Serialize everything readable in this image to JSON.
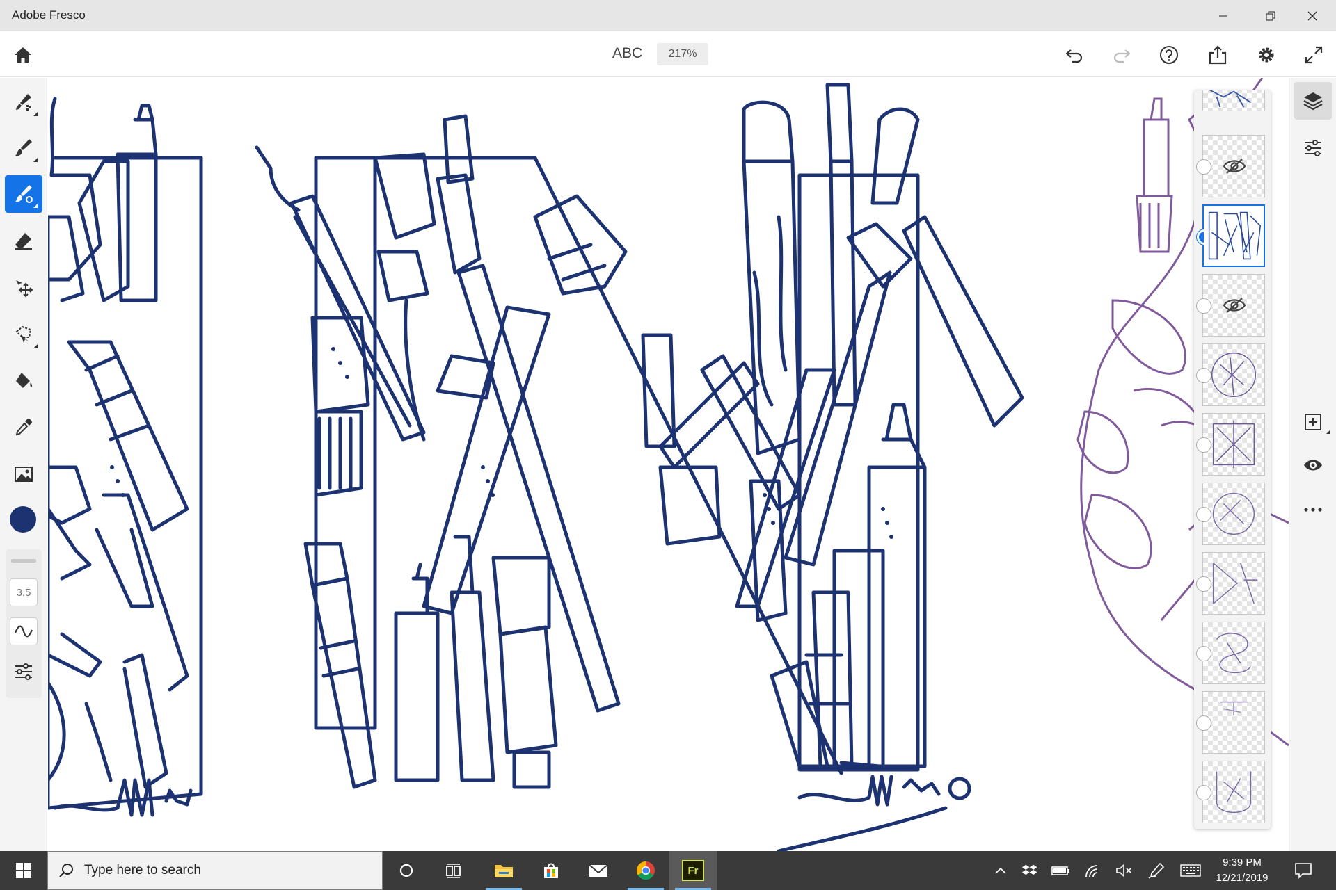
{
  "window": {
    "title": "Adobe Fresco"
  },
  "header": {
    "document_title": "ABC",
    "zoom": "217%"
  },
  "left_toolbar": {
    "tools": [
      "pixel-brush",
      "live-brush",
      "vector-brush",
      "eraser",
      "transform",
      "selection",
      "fill",
      "eyedropper",
      "place-image"
    ],
    "active_tool": "vector-brush",
    "color": "#1d3270",
    "brush_size": "3.5"
  },
  "layers_panel": {
    "layer_count": 11,
    "selected_layer": 3,
    "hidden_layers": [
      2,
      4
    ]
  },
  "canvas": {
    "ink_color": "#1d3270",
    "sketch_color": "#6b3f8a"
  },
  "taskbar": {
    "search_placeholder": "Type here to search",
    "time": "9:39 PM",
    "date": "12/21/2019",
    "pinned_apps": [
      "cortana",
      "task-view",
      "file-explorer",
      "microsoft-store",
      "mail",
      "chrome",
      "adobe-fresco"
    ],
    "fresco_label": "Fr"
  }
}
